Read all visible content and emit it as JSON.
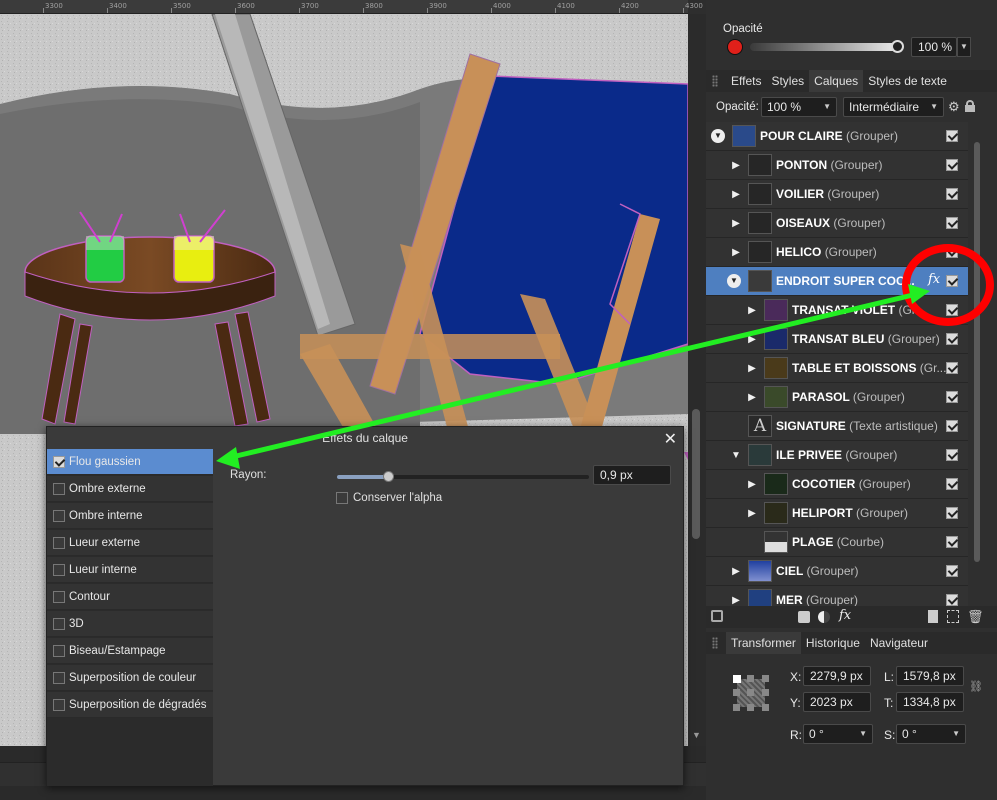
{
  "ruler": {
    "ticks": [
      "3300",
      "3400",
      "3500",
      "3600",
      "3700",
      "3800",
      "3900",
      "4000",
      "4100",
      "4200",
      "4300"
    ]
  },
  "top_panel": {
    "opacity_label": "Opacité",
    "opacity_value": "100 %",
    "opacity_level": 1.0,
    "color_swatch": "#e0201a"
  },
  "tabs": [
    "Effets",
    "Styles",
    "Calques",
    "Styles de texte"
  ],
  "active_tab": "Calques",
  "layer_controls": {
    "opacity_label": "Opacité:",
    "opacity_value": "100 %",
    "blend_mode": "Intermédiaire"
  },
  "layers": [
    {
      "name": "POUR CLAIRE",
      "type": "(Grouper)"
    },
    {
      "name": "PONTON",
      "type": "(Grouper)"
    },
    {
      "name": "VOILIER",
      "type": " (Grouper)"
    },
    {
      "name": "OISEAUX",
      "type": "(Grouper)"
    },
    {
      "name": "HELICO",
      "type": "(Grouper)"
    },
    {
      "name": "ENDROIT SUPER COC...",
      "type": "",
      "fx": "fx"
    },
    {
      "name": "TRANSAT VIOLET",
      "type": "(Gr"
    },
    {
      "name": "TRANSAT BLEU",
      "type": "(Grouper)"
    },
    {
      "name": "TABLE ET BOISSONS",
      "type": "(Gr..."
    },
    {
      "name": "PARASOL",
      "type": "(Grouper)"
    },
    {
      "name": "SIGNATURE",
      "type": "(Texte artistique)"
    },
    {
      "name": "ILE PRIVEE",
      "type": "(Grouper)"
    },
    {
      "name": "COCOTIER",
      "type": "(Grouper)"
    },
    {
      "name": "HELIPORT",
      "type": "(Grouper)"
    },
    {
      "name": "PLAGE",
      "type": "(Courbe)"
    },
    {
      "name": "CIEL",
      "type": "(Grouper)"
    },
    {
      "name": "MER",
      "type": "(Grouper)"
    }
  ],
  "layers_footer_fx": "fx",
  "transform": {
    "tabs": [
      "Transformer",
      "Historique",
      "Navigateur"
    ],
    "x_label": "X:",
    "x_value": "2279,9 px",
    "y_label": "Y:",
    "y_value": "2023 px",
    "l_label": "L:",
    "l_value": "1579,8 px",
    "t_label": "T:",
    "t_value": "1334,8 px",
    "r_label": "R:",
    "r_value": "0 °",
    "s_label": "S:",
    "s_value": "0 °"
  },
  "fx_dialog": {
    "title": "Effets du calque",
    "close": "✕",
    "effects": [
      {
        "label": "Flou gaussien",
        "checked": true
      },
      {
        "label": "Ombre externe",
        "checked": false
      },
      {
        "label": "Ombre interne",
        "checked": false
      },
      {
        "label": "Lueur externe",
        "checked": false
      },
      {
        "label": "Lueur interne",
        "checked": false
      },
      {
        "label": "Contour",
        "checked": false
      },
      {
        "label": "3D",
        "checked": false
      },
      {
        "label": "Biseau/Estampage",
        "checked": false
      },
      {
        "label": "Superposition de couleur",
        "checked": false
      },
      {
        "label": "Superposition de dégradés",
        "checked": false
      }
    ],
    "radius_label": "Rayon:",
    "radius_value": "0,9 px",
    "radius_level": 0.2,
    "preserve_alpha_label": "Conserver l'alpha",
    "preserve_alpha_checked": false
  },
  "colors": {
    "selection": "#4e7fc0",
    "highlight_circle": "#ff0000",
    "arrow": "#22ee22",
    "chair_blue": "#0a2a8a"
  }
}
